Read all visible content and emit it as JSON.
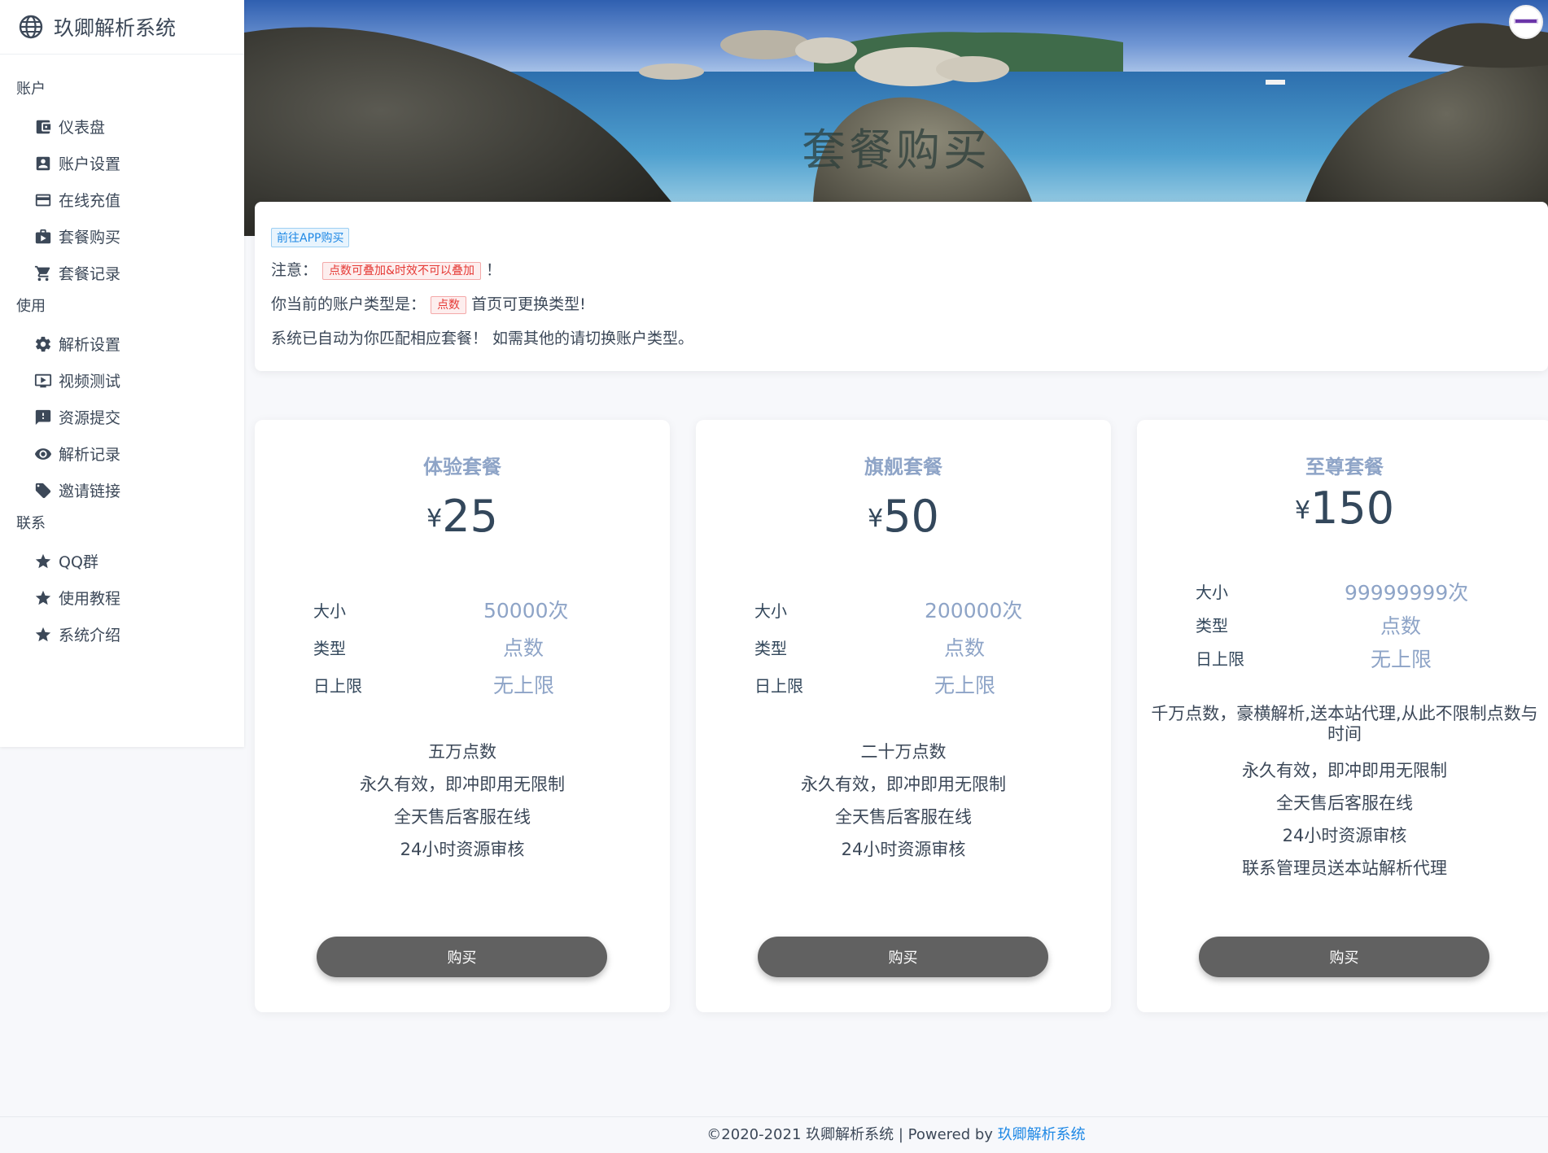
{
  "brand": {
    "title": "玖卿解析系统",
    "icon": "globe-icon"
  },
  "sidebar": {
    "sections": [
      {
        "label": "账户",
        "items": [
          {
            "label": "仪表盘",
            "icon": "wallet-icon"
          },
          {
            "label": "账户设置",
            "icon": "account-box-icon"
          },
          {
            "label": "在线充值",
            "icon": "credit-card-icon"
          },
          {
            "label": "套餐购买",
            "icon": "briefcase-icon"
          },
          {
            "label": "套餐记录",
            "icon": "cart-icon"
          }
        ]
      },
      {
        "label": "使用",
        "items": [
          {
            "label": "解析设置",
            "icon": "gear-icon"
          },
          {
            "label": "视频测试",
            "icon": "play-screen-icon"
          },
          {
            "label": "资源提交",
            "icon": "feedback-icon"
          },
          {
            "label": "解析记录",
            "icon": "eye-icon"
          },
          {
            "label": "邀请链接",
            "icon": "tag-icon"
          }
        ]
      },
      {
        "label": "联系",
        "items": [
          {
            "label": "QQ群",
            "icon": "star-icon"
          },
          {
            "label": "使用教程",
            "icon": "star-icon"
          },
          {
            "label": "系统介绍",
            "icon": "star-icon"
          }
        ]
      }
    ]
  },
  "hero": {
    "title": "套餐购买"
  },
  "notice": {
    "app_link": "前往APP购买",
    "line1_prefix": "注意：",
    "line1_tag": "点数可叠加&时效不可以叠加",
    "line1_suffix": "！",
    "line2_prefix": "你当前的账户类型是：",
    "line2_tag": "点数",
    "line2_suffix": "首页可更换类型!",
    "line3": "系统已自动为你匹配相应套餐！ 如需其他的请切换账户类型。"
  },
  "plans": [
    {
      "name": "体验套餐",
      "currency": "¥",
      "price": "25",
      "specs": [
        {
          "key": "大小",
          "value": "50000次"
        },
        {
          "key": "类型",
          "value": "点数"
        },
        {
          "key": "日上限",
          "value": "无上限"
        }
      ],
      "features": [
        "五万点数",
        "永久有效，即冲即用无限制",
        "全天售后客服在线",
        "24小时资源审核"
      ],
      "buy_label": "购买"
    },
    {
      "name": "旗舰套餐",
      "currency": "¥",
      "price": "50",
      "specs": [
        {
          "key": "大小",
          "value": "200000次"
        },
        {
          "key": "类型",
          "value": "点数"
        },
        {
          "key": "日上限",
          "value": "无上限"
        }
      ],
      "features": [
        "二十万点数",
        "永久有效，即冲即用无限制",
        "全天售后客服在线",
        "24小时资源审核"
      ],
      "buy_label": "购买"
    },
    {
      "name": "至尊套餐",
      "currency": "¥",
      "price": "150",
      "specs": [
        {
          "key": "大小",
          "value": "99999999次"
        },
        {
          "key": "类型",
          "value": "点数"
        },
        {
          "key": "日上限",
          "value": "无上限"
        }
      ],
      "features": [
        "千万点数，豪横解析,送本站代理,从此不限制点数与时间",
        "永久有效，即冲即用无限制",
        "全天售后客服在线",
        "24小时资源审核",
        "联系管理员送本站解析代理"
      ],
      "buy_label": "购买"
    }
  ],
  "footer": {
    "copyright": "©2020-2021 玖卿解析系统 | Powered by ",
    "link": "玖卿解析系统"
  },
  "colors": {
    "accent": "#1e88e5",
    "plan_name": "#8ea4c7",
    "buy_button": "#616161"
  }
}
